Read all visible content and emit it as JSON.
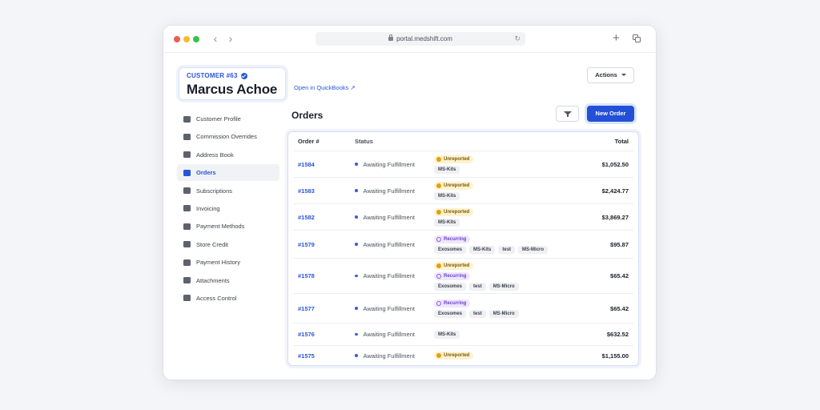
{
  "browser": {
    "url": "portal.medshift.com"
  },
  "customer": {
    "id_label": "CUSTOMER #63",
    "name": "Marcus Achoe",
    "quickbooks_link": "Open in QuickBooks ↗"
  },
  "header": {
    "actions_label": "Actions"
  },
  "sidebar": {
    "items": [
      {
        "label": "Customer Profile",
        "icon": "profile-card-icon"
      },
      {
        "label": "Commission Overrides",
        "icon": "sliders-icon"
      },
      {
        "label": "Address Book",
        "icon": "address-book-icon"
      },
      {
        "label": "Orders",
        "icon": "basket-icon",
        "active": true
      },
      {
        "label": "Subscriptions",
        "icon": "calendar-icon"
      },
      {
        "label": "Invoicing",
        "icon": "document-icon"
      },
      {
        "label": "Payment Methods",
        "icon": "credit-card-icon"
      },
      {
        "label": "Store Credit",
        "icon": "wallet-icon"
      },
      {
        "label": "Payment History",
        "icon": "history-icon"
      },
      {
        "label": "Attachments",
        "icon": "paperclip-icon"
      },
      {
        "label": "Access Control",
        "icon": "user-lock-icon"
      }
    ]
  },
  "orders": {
    "title": "Orders",
    "new_order_label": "New Order",
    "columns": {
      "order": "Order #",
      "status": "Status",
      "total": "Total"
    },
    "rows": [
      {
        "id": "#1584",
        "status": "Awaiting Fulfillment",
        "badges": [
          "Unreported"
        ],
        "tags": [
          "MS-Kits"
        ],
        "total": "$1,052.50"
      },
      {
        "id": "#1583",
        "status": "Awaiting Fulfillment",
        "badges": [
          "Unreported"
        ],
        "tags": [
          "MS-Kits"
        ],
        "total": "$2,424.77"
      },
      {
        "id": "#1582",
        "status": "Awaiting Fulfillment",
        "badges": [
          "Unreported"
        ],
        "tags": [
          "MS-Kits"
        ],
        "total": "$3,869.27"
      },
      {
        "id": "#1579",
        "status": "Awaiting Fulfillment",
        "badges": [
          "Recurring"
        ],
        "tags": [
          "Exosomes",
          "MS-Kits",
          "test",
          "MS-Micro"
        ],
        "total": "$95.87"
      },
      {
        "id": "#1578",
        "status": "Awaiting Fulfillment",
        "badges": [
          "Unreported",
          "Recurring"
        ],
        "tags": [
          "Exosomes",
          "test",
          "MS-Micro"
        ],
        "total": "$65.42"
      },
      {
        "id": "#1577",
        "status": "Awaiting Fulfillment",
        "badges": [
          "Recurring"
        ],
        "tags": [
          "Exosomes",
          "test",
          "MS-Micro"
        ],
        "total": "$65.42"
      },
      {
        "id": "#1576",
        "status": "Awaiting Fulfillment",
        "badges": [],
        "tags": [
          "MS-Kits"
        ],
        "total": "$632.52"
      },
      {
        "id": "#1575",
        "status": "Awaiting Fulfillment",
        "badges": [
          "Unreported"
        ],
        "tags": [],
        "total": "$1,155.00"
      }
    ]
  },
  "colors": {
    "accent": "#2855d8",
    "unreported_bg": "#fdf2d0",
    "recurring_bg": "#efe6fd"
  }
}
